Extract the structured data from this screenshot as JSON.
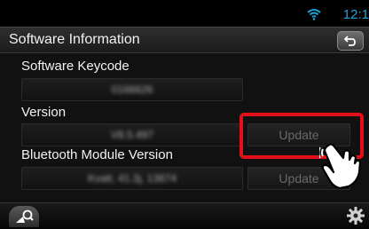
{
  "status_bar": {
    "clock": "12:1"
  },
  "header": {
    "title": "Software Information"
  },
  "sections": {
    "software_keycode": {
      "label": "Software Keycode",
      "value": "0166626"
    },
    "version": {
      "label": "Version",
      "value": "V8.5.497",
      "update_label": "Update"
    },
    "bluetooth": {
      "label": "Bluetooth Module Version",
      "value": "Kvatt, 41.3j, 13874",
      "update_label": "Update"
    }
  },
  "colors": {
    "accent": "#1fa3d9",
    "highlight": "#e3101a"
  },
  "icons": {
    "back": "back-arrow-icon",
    "nav": "navigation-icon",
    "settings": "gear-icon",
    "wifi": "wifi-icon",
    "pointer": "hand-pointer-icon"
  }
}
